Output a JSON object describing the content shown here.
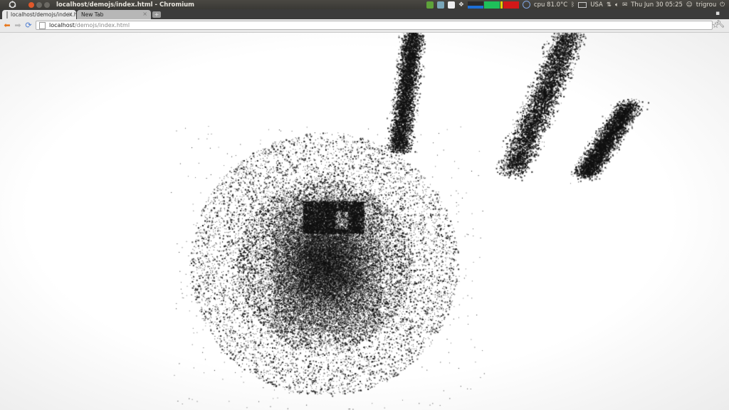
{
  "window": {
    "title": "localhost/demojs/index.html - Chromium"
  },
  "system_tray": {
    "cpu": "cpu 81.0°C",
    "keyboard": "USA",
    "datetime": "Thu Jun 30 05:25",
    "user": "trigrou"
  },
  "tabs": [
    {
      "label": "localhost/demojs/index.ht",
      "active": true
    },
    {
      "label": "New Tab",
      "active": false
    }
  ],
  "toolbar": {
    "url_host": "localhost",
    "url_path": "/demojs/index.html"
  },
  "colors": {
    "panel": "#3c3b37",
    "tab_active": "#e9e9e9",
    "back_arrow": "#e8761a",
    "reload": "#4a7bd1",
    "particles": "#111111"
  },
  "icons": {
    "back": "back-arrow-icon",
    "forward": "forward-arrow-icon",
    "reload": "reload-icon",
    "star": "bookmark-star-icon",
    "wrench": "wrench-menu-icon"
  }
}
